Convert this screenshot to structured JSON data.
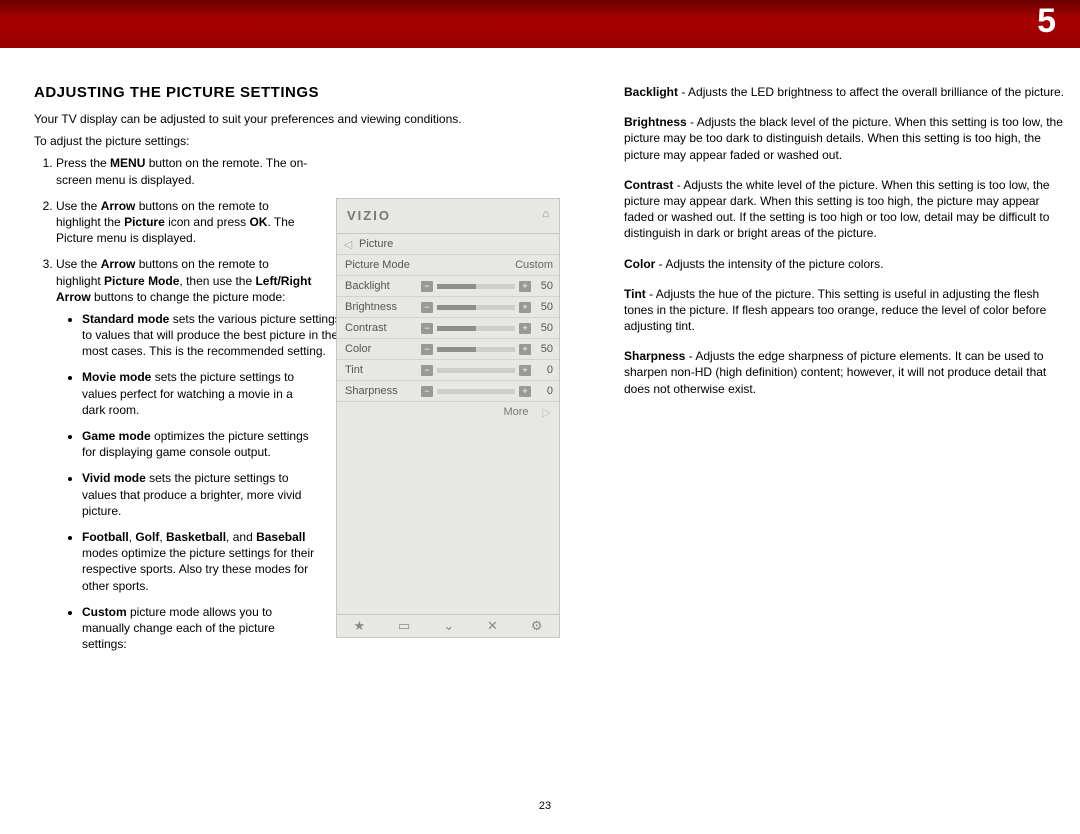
{
  "page_number": "23",
  "section_number": "5",
  "heading": "ADJUSTING THE PICTURE SETTINGS",
  "intro": "Your TV display can be adjusted to suit your preferences and viewing conditions.",
  "lead": "To adjust the picture settings:",
  "steps": {
    "s1a": "Press the ",
    "s1b": "MENU",
    "s1c": " button on the remote. The on-screen menu is displayed.",
    "s2a": "Use the ",
    "s2b": "Arrow",
    "s2c": " buttons on the remote to highlight the ",
    "s2d": "Picture",
    "s2e": " icon and press ",
    "s2f": "OK",
    "s2g": ". The Picture menu is displayed.",
    "s3a": "Use the ",
    "s3b": "Arrow",
    "s3c": " buttons on the remote to highlight ",
    "s3d": "Picture Mode",
    "s3e": ", then use the ",
    "s3f": "Left/Right Arrow",
    "s3g": " buttons to change the picture mode:"
  },
  "modes": {
    "std_b": "Standard mode",
    "std_t": " sets the various picture settings to values that will produce the best picture in the most cases. This is the recommended setting.",
    "mov_b": "Movie mode",
    "mov_t": " sets the picture settings to values perfect for watching a movie in a dark room.",
    "gam_b": "Game mode",
    "gam_t": " optimizes the picture settings for displaying game console output.",
    "viv_b": "Vivid mode",
    "viv_t": " sets the picture settings to values that produce a brighter, more vivid picture.",
    "spt_b1": "Football",
    "spt_b2": "Golf",
    "spt_b3": "Basketball",
    "spt_b4": "Baseball",
    "spt_t": " modes optimize the picture settings for their respective sports. Also try these modes for other sports.",
    "cus_b": "Custom",
    "cus_t": " picture mode allows you to manually change each of the picture settings:"
  },
  "definitions": {
    "backlight_b": "Backlight",
    "backlight_t": " - Adjusts the LED brightness to affect the overall brilliance of the picture.",
    "brightness_b": "Brightness",
    "brightness_t": " - Adjusts the black level of the picture. When this setting is too low, the picture may be too dark to distinguish details. When this setting is too high, the picture may appear faded or washed out.",
    "contrast_b": "Contrast",
    "contrast_t": " - Adjusts the white level of the picture. When this setting is too low, the picture may appear dark. When this setting is too high, the picture may appear faded or washed out. If the setting is too high or too low, detail may be difficult to distinguish in dark or bright areas of the picture.",
    "color_b": "Color",
    "color_t": " - Adjusts the intensity of the picture colors.",
    "tint_b": "Tint",
    "tint_t": " - Adjusts the hue of the picture. This setting is useful in adjusting the flesh tones in the picture. If flesh appears too orange, reduce the level of color before adjusting tint.",
    "sharp_b": "Sharpness",
    "sharp_t": " - Adjusts the edge sharpness of picture elements. It can be used to sharpen non-HD (high definition) content; however, it will not produce detail that does not otherwise exist."
  },
  "osd": {
    "brand": "VIZIO",
    "crumb": "Picture",
    "rows": [
      {
        "label": "Picture Mode",
        "value": "Custom"
      },
      {
        "label": "Backlight",
        "value": "50"
      },
      {
        "label": "Brightness",
        "value": "50"
      },
      {
        "label": "Contrast",
        "value": "50"
      },
      {
        "label": "Color",
        "value": "50"
      },
      {
        "label": "Tint",
        "value": "0"
      },
      {
        "label": "Sharpness",
        "value": "0"
      }
    ],
    "more": "More"
  }
}
